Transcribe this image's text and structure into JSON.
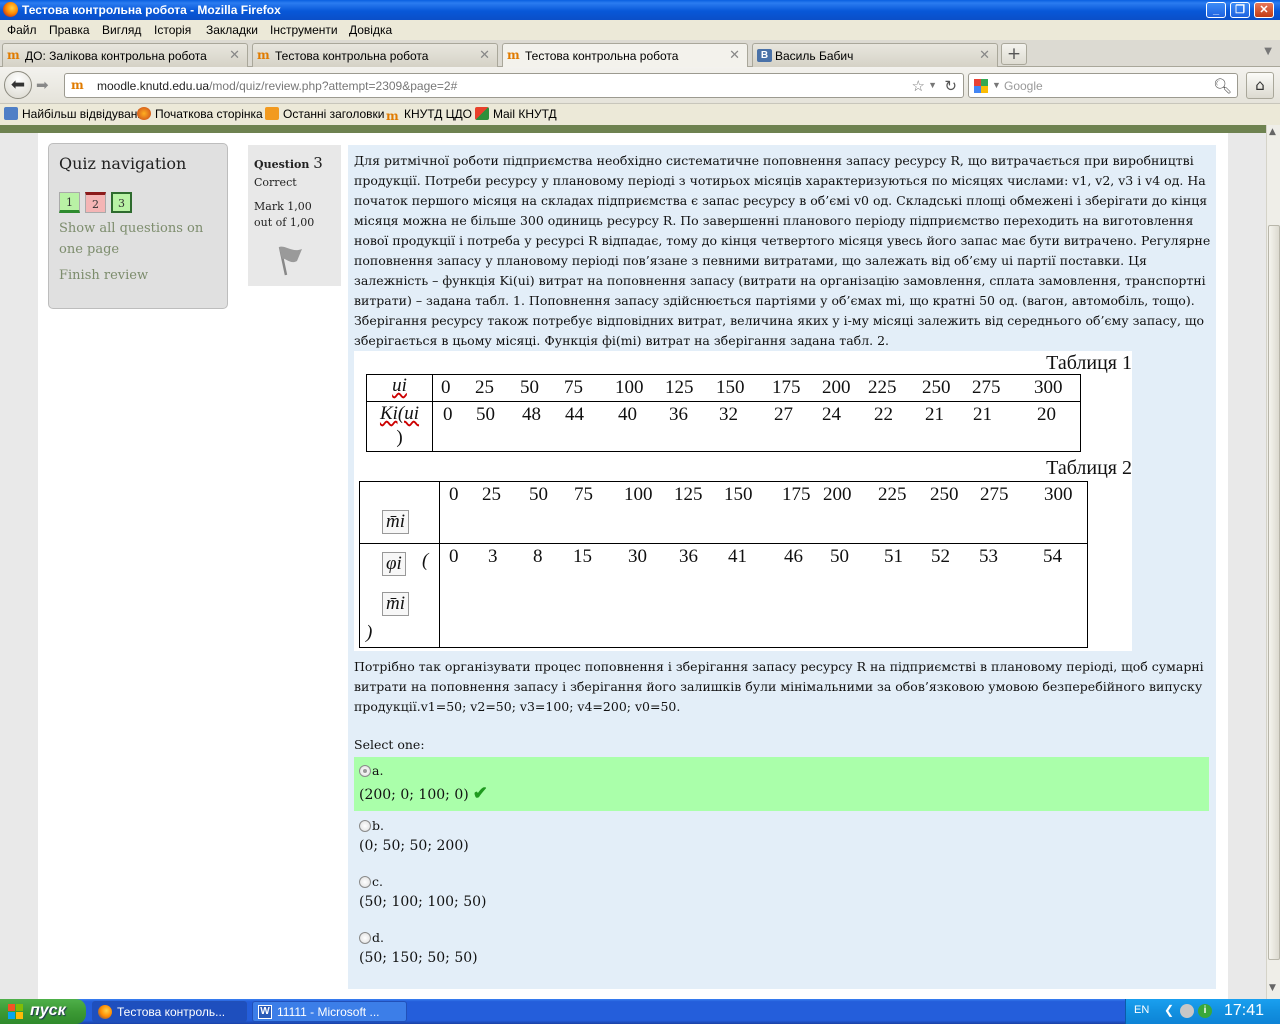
{
  "window": {
    "title": "Тестова контрольна робота - Mozilla Firefox"
  },
  "menu": [
    "Файл",
    "Правка",
    "Вигляд",
    "Історія",
    "Закладки",
    "Інструменти",
    "Довідка"
  ],
  "tabs": [
    {
      "label": "ДО: Залікова контрольна робота",
      "favicon": "moodle-icon"
    },
    {
      "label": "Тестова контрольна робота",
      "favicon": "moodle-icon"
    },
    {
      "label": "Тестова контрольна робота",
      "favicon": "moodle-icon",
      "active": true
    },
    {
      "label": "Василь Бабич",
      "favicon": "vk-icon"
    }
  ],
  "nav": {
    "url_host": "moodle.knutd.edu.ua",
    "url_path": "/mod/quiz/review.php?attempt=2309&page=2#",
    "search_placeholder": "Google"
  },
  "bookmarks": [
    "Найбільш відвідувані",
    "Початкова сторінка",
    "Останні заголовки",
    "КНУТД ЦДО",
    "Mail КНУТД"
  ],
  "quiz_nav": {
    "title": "Quiz navigation",
    "questions": [
      {
        "number": "1",
        "state": "correct"
      },
      {
        "number": "2",
        "state": "incorrect"
      },
      {
        "number": "3",
        "state": "current-correct"
      }
    ],
    "show_all_line1": "Show all questions on",
    "show_all_line2": "one page",
    "finish": "Finish review"
  },
  "question": {
    "label": "Question",
    "number": "3",
    "state": "Correct",
    "mark_line1": "Mark 1,00",
    "mark_line2": "out of 1,00",
    "text": "Для ритмічної роботи підприємства необхідно систематичне поповнення запасу ресурсу R, що витрачається при виробництві продукції. Потреби ресурсу у плановому періоді з чотирьох місяців характеризуються по місяцях числами: v1, v2, v3 і v4 од. На початок першого місяця на складах підприємства є запас ресурсу в об’ємі v0 од. Складські площі обмежені і зберігати до кінця місяця можна не більше 300 одиниць ресурсу R. По завершенні планового періоду підприємство переходить на виготовлення нової продукції і потреба у ресурсі R відпадає, тому до кінця четвертого місяця увесь його запас має бути витрачено. Регулярне поповнення запасу у плановому періоді пов’язане з певними витратами, що залежать від об’єму ui партії поставки. Ця залежність – функція Ki(ui) витрат на поповнення запасу (витрати на організацію замовлення, сплата замовлення, транспортні витрати) – задана табл. 1. Поповнення запасу здійснюється партіями у об’ємах mi, що кратні 50 од. (вагон, автомобіль, тощо). Зберігання ресурсу також потребує відповідних витрат, величина яких у i-му місяці залежить від середнього об’єму запасу, що зберігається в цьому місяці. Функція фі(mi) витрат на зберігання задана табл. 2.",
    "table1": {
      "caption": "Таблиця 1",
      "row1_label": "ui",
      "row1_values": [
        "0",
        "25",
        "50",
        "75",
        "100",
        "125",
        "150",
        "175",
        "200",
        "225",
        "250",
        "275",
        "300"
      ],
      "row2_label": "Ki(ui",
      "row2_label_close": ")",
      "row2_values": [
        "0",
        "50",
        "48",
        "44",
        "40",
        "36",
        "32",
        "27",
        "24",
        "22",
        "21",
        "21",
        "20"
      ]
    },
    "table2": {
      "caption": "Таблиця 2",
      "row1_label": "m̄i",
      "row1_values": [
        "0",
        "25",
        "50",
        "75",
        "100",
        "125",
        "150",
        "175",
        "200",
        "225",
        "250",
        "275",
        "300"
      ],
      "row2_label": "φi",
      "row2_open": "(",
      "row2_sub": "m̄i",
      "row2_close": ")",
      "row2_values": [
        "0",
        "3",
        "8",
        "15",
        "30",
        "36",
        "41",
        "46",
        "50",
        "51",
        "52",
        "53",
        "54"
      ]
    },
    "text2": "Потрібно так організувати процес поповнення і зберігання запасу ресурсу R на підприємстві в плановому періоді, щоб сумарні витрати на поповнення запасу і зберігання його залишків були мінімальними за обов’язковою умовою безперебійного випуску продукції.v1=50; v2=50; v3=100; v4=200; v0=50.",
    "select_one": "Select one:",
    "answers": [
      {
        "letter": "a.",
        "value": "(200; 0; 100; 0)",
        "selected": true,
        "correct": true
      },
      {
        "letter": "b.",
        "value": "(0; 50; 50; 200)",
        "selected": false,
        "correct": false
      },
      {
        "letter": "c.",
        "value": "(50; 100; 100; 50)",
        "selected": false,
        "correct": false
      },
      {
        "letter": "d.",
        "value": "(50; 150; 50; 50)",
        "selected": false,
        "correct": false
      }
    ]
  },
  "taskbar": {
    "start": "пуск",
    "tasks": [
      {
        "label": "Тестова контроль...",
        "icon": "firefox-icon",
        "active": true
      },
      {
        "label": "11111 - Microsoft ...",
        "icon": "word-icon",
        "active": false
      }
    ],
    "lang": "EN",
    "clock": "17:41"
  },
  "colors": {
    "correct_bg": "#aaffaa",
    "content_bg": "#e3eef8",
    "title_bar": "#0a5fe0",
    "taskbar": "#245edb",
    "start": "#3c9a35"
  }
}
